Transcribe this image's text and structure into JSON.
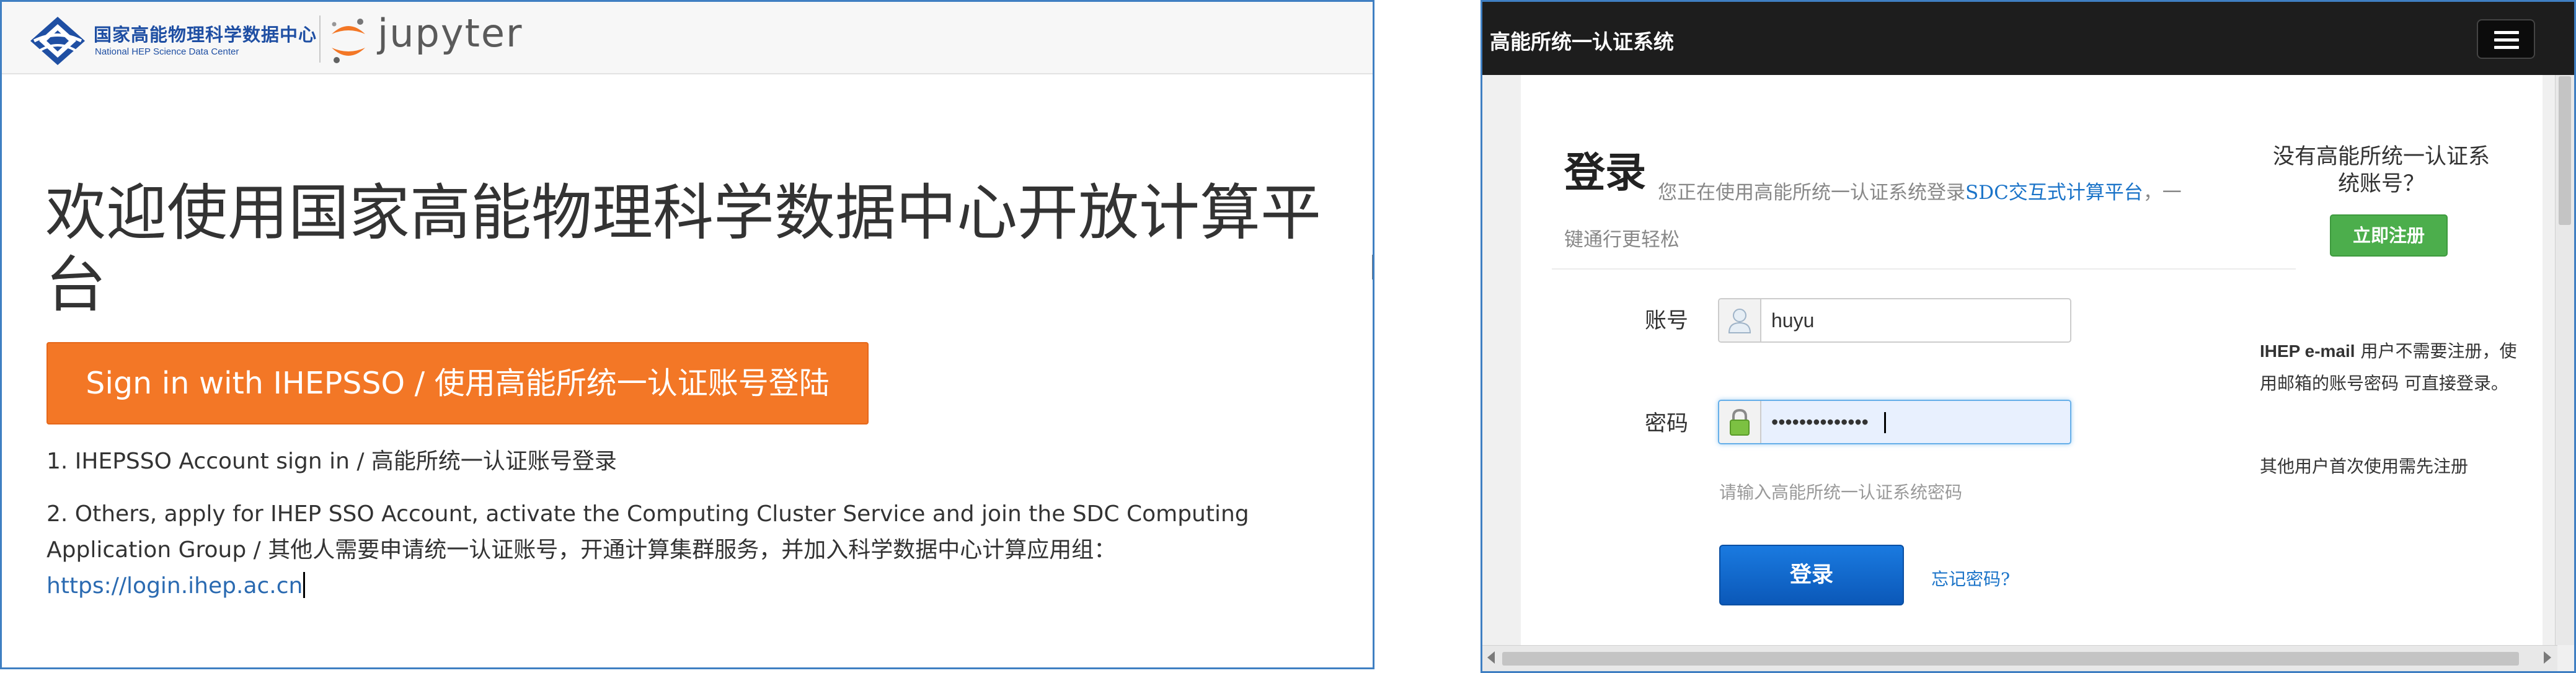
{
  "left_window": {
    "header": {
      "org_name_zh": "国家高能物理科学数据中心",
      "org_name_en": "National HEP Science Data Center",
      "app_name": "jupyter"
    },
    "welcome_title": "欢迎使用国家高能物理科学数据中心开放计算平台",
    "sso_button_label": "Sign in with IHEPSSO / 使用高能所统一认证账号登陆",
    "info_line_1": "1. IHEPSSO Account sign in / 高能所统一认证账号登录",
    "info_line_2": "2. Others, apply for IHEP SSO Account, activate the Computing Cluster Service and join the SDC Computing Application Group / 其他人需要申请统一认证账号，开通计算集群服务，并加入科学数据中心计算应用组：",
    "info_link": "https://login.ihep.ac.cn",
    "colors": {
      "accent_orange": "#f37726",
      "brand_blue": "#1f4fa3",
      "link_blue": "#2a6ab1"
    }
  },
  "right_window": {
    "navbar": {
      "title": "高能所统一认证系统",
      "menu_icon": "hamburger-icon"
    },
    "login": {
      "heading": "登录",
      "desc_prefix": "您正在使用高能所统一认证系统登录",
      "desc_link": "SDC交互式计算平台",
      "desc_suffix": "，一",
      "desc_line2": "键通行更轻松",
      "username_label": "账号",
      "username_value": "huyu",
      "username_icon": "user-icon",
      "password_label": "密码",
      "password_value": "••••••••••••••",
      "password_icon": "lock-icon",
      "password_hint": "请输入高能所统一认证系统密码",
      "submit_label": "登录",
      "forgot_label": "忘记密码?"
    },
    "register": {
      "question": "没有高能所统一认证系统账号？",
      "button_label": "立即注册",
      "note_bold": "IHEP e-mail",
      "note_rest": " 用户不需要注册，使用邮箱的账号密码 可直接登录。",
      "note2": "其他用户首次使用需先注册"
    },
    "colors": {
      "navbar_bg": "#1d1d1d",
      "primary_blue": "#0b58b8",
      "success_green": "#4cae4c",
      "link_blue": "#1a73c8"
    }
  }
}
